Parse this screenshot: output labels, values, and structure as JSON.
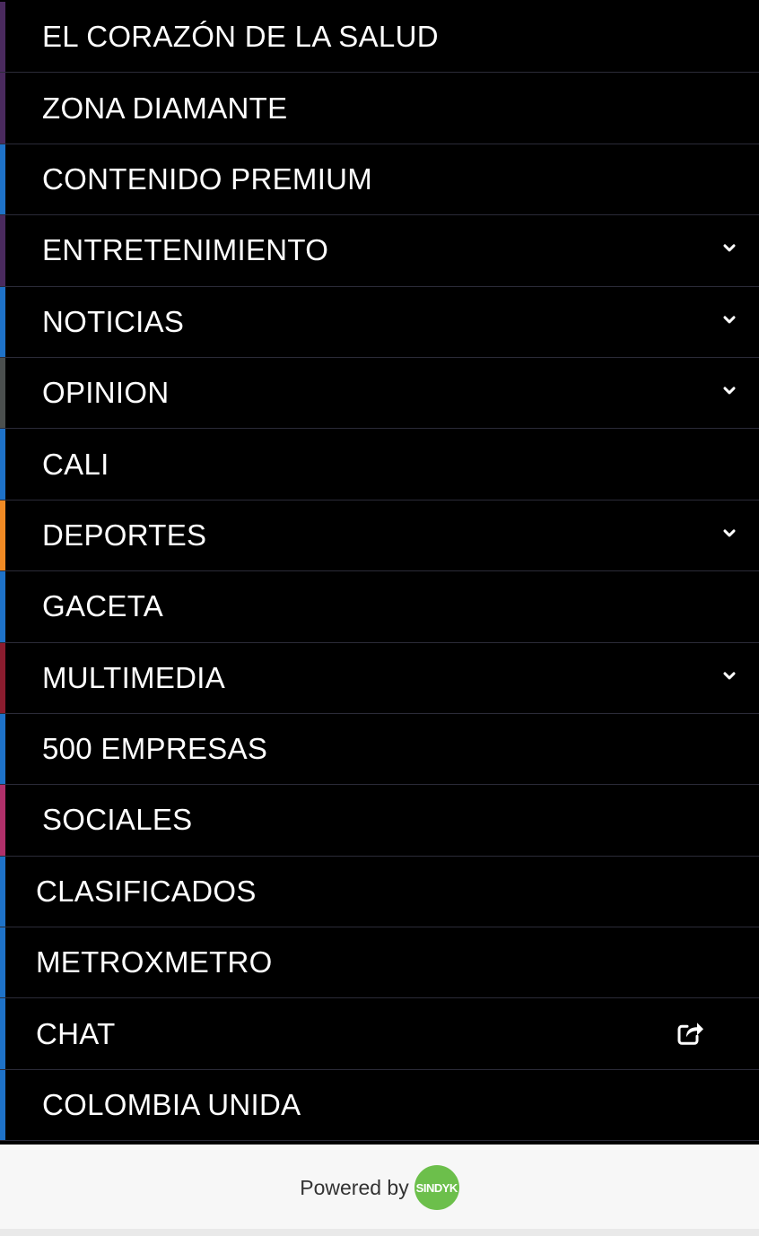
{
  "menu": {
    "items": [
      {
        "label": "EL CORAZÓN DE LA SALUD",
        "accent": "#4a2a5e",
        "has_chevron": false
      },
      {
        "label": "ZONA DIAMANTE",
        "accent": "#4a2a5e",
        "has_chevron": false
      },
      {
        "label": "CONTENIDO PREMIUM",
        "accent": "#1e72c8",
        "has_chevron": false
      },
      {
        "label": "ENTRETENIMIENTO",
        "accent": "#4a2a5e",
        "has_chevron": true
      },
      {
        "label": "NOTICIAS",
        "accent": "#1e72c8",
        "has_chevron": true
      },
      {
        "label": "OPINION",
        "accent": "#4b4f4e",
        "has_chevron": true
      },
      {
        "label": "CALI",
        "accent": "#1e72c8",
        "has_chevron": false
      },
      {
        "label": "DEPORTES",
        "accent": "#f08a24",
        "has_chevron": true
      },
      {
        "label": "GACETA",
        "accent": "#1e72c8",
        "has_chevron": false
      },
      {
        "label": "MULTIMEDIA",
        "accent": "#8a1c2e",
        "has_chevron": true
      },
      {
        "label": "500 EMPRESAS",
        "accent": "#1e72c8",
        "has_chevron": false
      },
      {
        "label": "SOCIALES",
        "accent": "#b0306a",
        "has_chevron": false
      },
      {
        "label": "CLASIFICADOS",
        "accent": "#1e72c8",
        "has_chevron": false,
        "indent_less": true
      },
      {
        "label": "METROXMETRO",
        "accent": "#1e72c8",
        "has_chevron": false,
        "indent_less": true
      },
      {
        "label": "CHAT",
        "accent": "#1e72c8",
        "has_chevron": false,
        "indent_less": true,
        "has_share": true
      },
      {
        "label": "COLOMBIA UNIDA",
        "accent": "#1e72c8",
        "has_chevron": false
      }
    ]
  },
  "footer": {
    "powered_by": "Powered by",
    "brand": "SINDYK",
    "brand_color": "#6cbf4b"
  },
  "icons": {
    "chevron": "chevron-down-icon",
    "share": "share-icon"
  }
}
